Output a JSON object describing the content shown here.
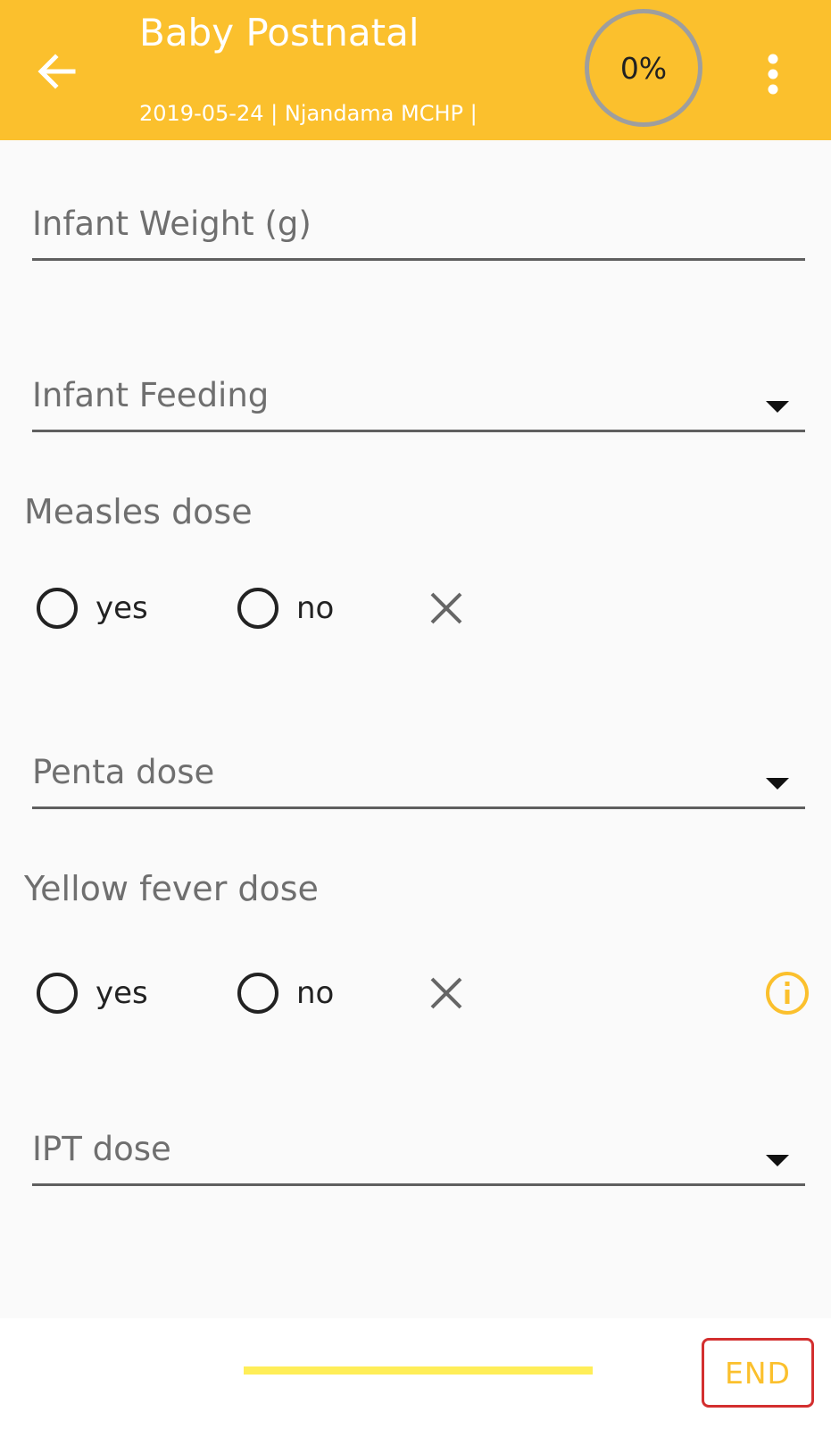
{
  "header": {
    "title": "Baby Postnatal",
    "subtitle": "2019-05-24 | Njandama MCHP |",
    "progress": "0%",
    "back_icon": "arrow-left-icon",
    "menu_icon": "more-vert-icon"
  },
  "form": {
    "infant_weight": {
      "placeholder": "Infant Weight (g)",
      "value": ""
    },
    "infant_feeding": {
      "label": "Infant Feeding",
      "selected": ""
    },
    "measles_dose": {
      "question": "Measles dose",
      "options": [
        "yes",
        "no"
      ],
      "selected": null
    },
    "penta_dose": {
      "label": "Penta dose",
      "selected": ""
    },
    "yellow_fever_dose": {
      "question": "Yellow fever dose",
      "options": [
        "yes",
        "no"
      ],
      "selected": null,
      "info_icon": "info-icon"
    },
    "ipt_dose": {
      "label": "IPT dose",
      "selected": ""
    }
  },
  "footer": {
    "end_label": "END",
    "progress_fraction": 0
  },
  "colors": {
    "primary": "#FBC02D",
    "end_border": "#D32F2F",
    "progress_track": "#FFEE58"
  }
}
